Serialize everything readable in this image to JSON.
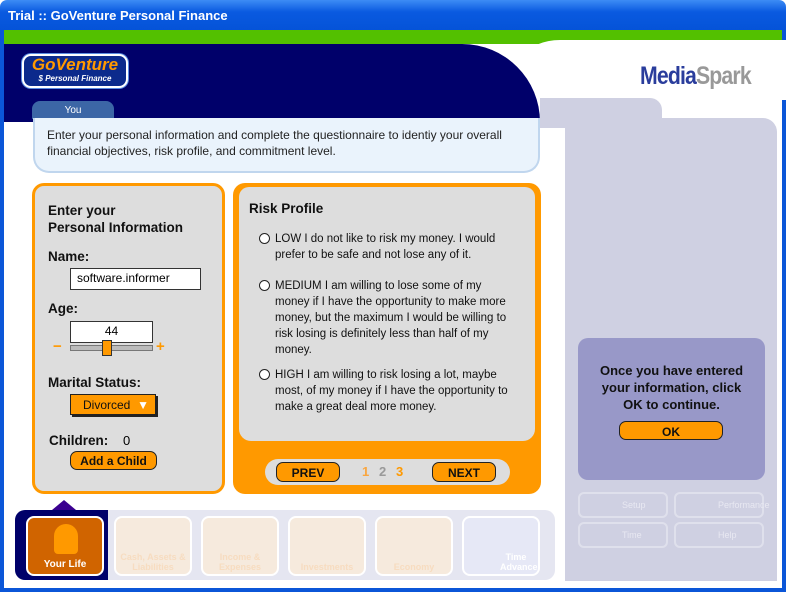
{
  "window": {
    "title": "Trial :: GoVenture Personal Finance"
  },
  "brand": {
    "logo_line1": "GoVenture",
    "logo_line2": "$ Personal Finance",
    "partner_a": "Media",
    "partner_b": "Spark"
  },
  "tab": {
    "label": "You"
  },
  "instructions": "Enter your personal information and complete the questionnaire to identiy your overall financial objectives, risk profile, and commitment level.",
  "personal": {
    "heading_line1": "Enter your",
    "heading_line2": "Personal Information",
    "name_label": "Name:",
    "name_value": "software.informer",
    "age_label": "Age:",
    "age_value": "44",
    "age_slider_fraction": 0.44,
    "minus": "−",
    "plus": "+",
    "marital_label": "Marital Status:",
    "marital_value": "Divorced",
    "children_label": "Children:",
    "children_value": "0",
    "add_child": "Add a Child"
  },
  "risk": {
    "heading": "Risk Profile",
    "options": [
      {
        "text": "LOW I do not like to risk my money.  I would prefer to be safe and not lose any of it."
      },
      {
        "text": "MEDIUM I am willing to lose some of my money if I have the opportunity to make more money, but the maximum I would be willing to risk losing is definitely less than half of my money."
      },
      {
        "text": "HIGH I am willing to risk losing a lot, maybe most, of my money if I have the opportunity to make a great deal more money."
      }
    ],
    "prev": "PREV",
    "next": "NEXT",
    "pages": [
      "1",
      "2",
      "3"
    ],
    "current_page": "3"
  },
  "ok_panel": {
    "message": "Once you have entered your information, click OK to continue.",
    "ok": "OK"
  },
  "tools": [
    "Setup",
    "Performance",
    "Time",
    "Help"
  ],
  "nav": [
    "Your Life",
    "Cash, Assets & Liabilities",
    "Income & Expenses",
    "Investments",
    "Economy",
    "Time Advance"
  ],
  "colors": {
    "accent": "#ff9900",
    "navy": "#00006a",
    "green": "#53c000"
  }
}
